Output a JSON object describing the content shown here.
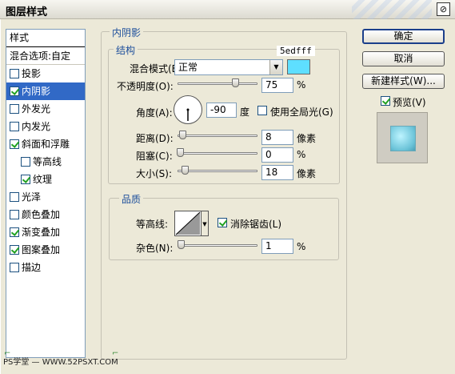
{
  "window": {
    "title": "图层样式",
    "close_glyph": "⊘"
  },
  "styles_panel": {
    "header": "样式",
    "blend_options": "混合选项:自定",
    "items": [
      {
        "label": "投影",
        "checked": false,
        "selected": false,
        "sub": false
      },
      {
        "label": "内阴影",
        "checked": true,
        "selected": true,
        "sub": false
      },
      {
        "label": "外发光",
        "checked": false,
        "selected": false,
        "sub": false
      },
      {
        "label": "内发光",
        "checked": false,
        "selected": false,
        "sub": false
      },
      {
        "label": "斜面和浮雕",
        "checked": true,
        "selected": false,
        "sub": false
      },
      {
        "label": "等高线",
        "checked": false,
        "selected": false,
        "sub": true
      },
      {
        "label": "纹理",
        "checked": true,
        "selected": false,
        "sub": true
      },
      {
        "label": "光泽",
        "checked": false,
        "selected": false,
        "sub": false
      },
      {
        "label": "颜色叠加",
        "checked": false,
        "selected": false,
        "sub": false
      },
      {
        "label": "渐变叠加",
        "checked": true,
        "selected": false,
        "sub": false
      },
      {
        "label": "图案叠加",
        "checked": true,
        "selected": false,
        "sub": false
      },
      {
        "label": "描边",
        "checked": false,
        "selected": false,
        "sub": false
      }
    ]
  },
  "inner_shadow": {
    "title": "内阴影",
    "structure": {
      "title": "结构",
      "blend_mode_label": "混合模式(B):",
      "blend_mode_value": "正常",
      "color_hex": "5edfff",
      "color": "#5edfff",
      "opacity_label": "不透明度(O):",
      "opacity_value": "75",
      "opacity_unit": "%",
      "opacity_fraction": 0.75,
      "angle_label": "角度(A):",
      "angle_value": "-90",
      "angle_unit": "度",
      "global_light_label": "使用全局光(G)",
      "global_light_checked": false,
      "distance_label": "距离(D):",
      "distance_value": "8",
      "distance_unit": "像素",
      "distance_fraction": 0.03,
      "choke_label": "阻塞(C):",
      "choke_value": "0",
      "choke_unit": "%",
      "choke_fraction": 0.0,
      "size_label": "大小(S):",
      "size_value": "18",
      "size_unit": "像素",
      "size_fraction": 0.07
    },
    "quality": {
      "title": "品质",
      "contour_label": "等高线:",
      "antialias_label": "消除锯齿(L)",
      "antialias_checked": true,
      "noise_label": "杂色(N):",
      "noise_value": "1",
      "noise_unit": "%",
      "noise_fraction": 0.01
    }
  },
  "buttons": {
    "ok": "确定",
    "cancel": "取消",
    "new_style": "新建样式(W)...",
    "preview_label": "预览(V)",
    "preview_checked": true
  },
  "watermark": "PS学堂 — WWW.52PSXT.COM"
}
